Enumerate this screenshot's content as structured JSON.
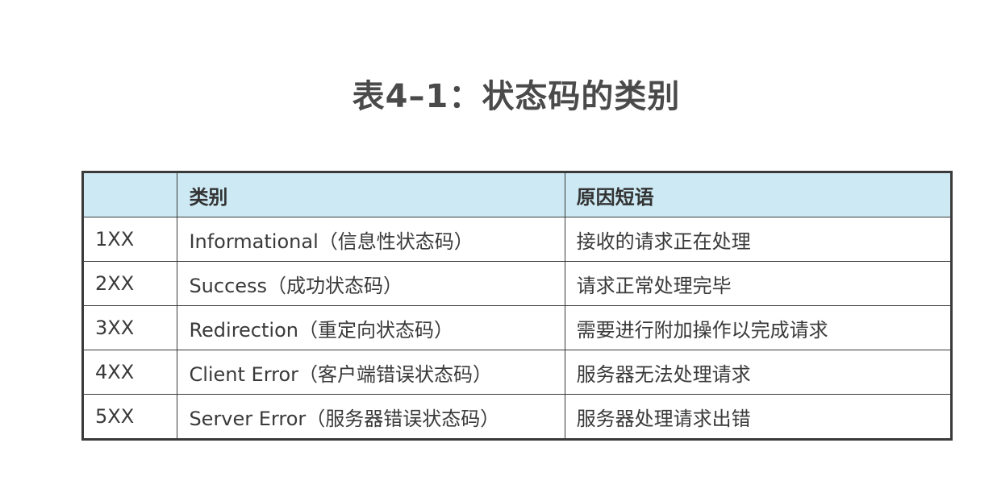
{
  "title": "表4–1：状态码的类别",
  "table": {
    "headers": [
      "",
      "类别",
      "原因短语"
    ],
    "rows": [
      {
        "code": "1XX",
        "category": "Informational（信息性状态码）",
        "reason": "接收的请求正在处理"
      },
      {
        "code": "2XX",
        "category": "Success（成功状态码）",
        "reason": "请求正常处理完毕"
      },
      {
        "code": "3XX",
        "category": "Redirection（重定向状态码）",
        "reason": "需要进行附加操作以完成请求"
      },
      {
        "code": "4XX",
        "category": "Client Error（客户端错误状态码）",
        "reason": "服务器无法处理请求"
      },
      {
        "code": "5XX",
        "category": "Server Error（服务器错误状态码）",
        "reason": "服务器处理请求出错"
      }
    ]
  }
}
